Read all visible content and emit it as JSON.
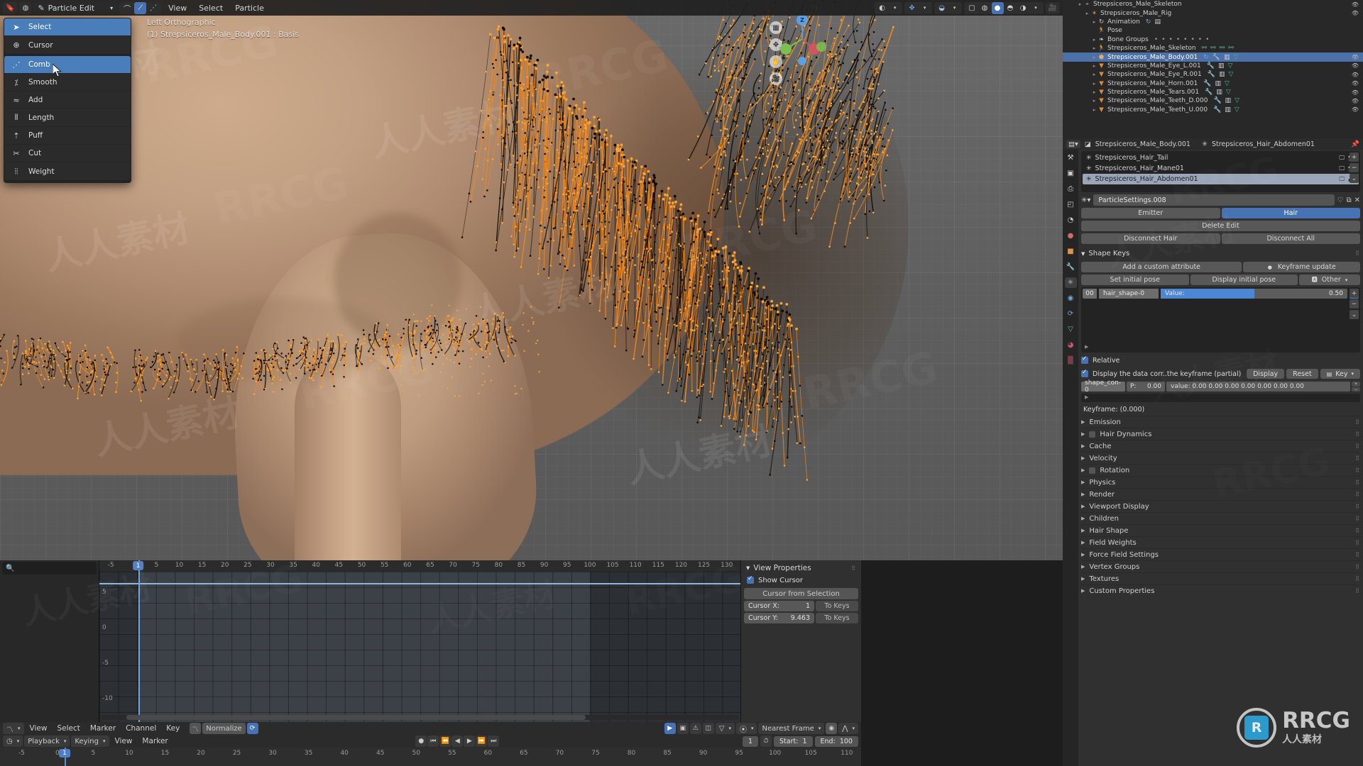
{
  "viewport": {
    "header": {
      "editor_type": "editor-type-icon",
      "mode": "Particle Edit",
      "menus": [
        "View",
        "Select",
        "Particle"
      ],
      "select_modes": [
        "path-select",
        "point-select",
        "tip-select"
      ]
    },
    "overlay_line1": "Left Orthographic",
    "overlay_line2": "(1) Strepsiceros_Male_Body.001 : Basis",
    "gizmo_axes": [
      "Z",
      "Y",
      "X"
    ]
  },
  "tool_menu": {
    "groups": [
      [
        {
          "label": "Select",
          "icon": "cursor-select-icon",
          "selected": true
        },
        {
          "label": "Cursor",
          "icon": "cursor-3d-icon",
          "selected": false
        }
      ],
      [
        {
          "label": "Comb",
          "icon": "comb-icon",
          "selected": true
        },
        {
          "label": "Smooth",
          "icon": "smooth-icon",
          "selected": false
        },
        {
          "label": "Add",
          "icon": "add-icon",
          "selected": false
        },
        {
          "label": "Length",
          "icon": "length-icon",
          "selected": false
        },
        {
          "label": "Puff",
          "icon": "puff-icon",
          "selected": false
        },
        {
          "label": "Cut",
          "icon": "cut-icon",
          "selected": false
        },
        {
          "label": "Weight",
          "icon": "weight-icon",
          "selected": false
        }
      ]
    ]
  },
  "outliner": {
    "rows": [
      {
        "label": "Strepsiceros_Male_Skeleton",
        "indent": 2,
        "icon": "armature-icon",
        "icon_color": "#d89a5a",
        "disclosure": true,
        "eye": true,
        "selected": false,
        "extra": []
      },
      {
        "label": "Strepsiceros_Male_Rig",
        "indent": 3,
        "icon": "armature-data-icon",
        "icon_color": "#e08a3c",
        "disclosure": true,
        "eye": true,
        "selected": false,
        "extra": []
      },
      {
        "label": "Animation",
        "indent": 4,
        "icon": "animation-icon",
        "icon_color": "#cfcfcf",
        "disclosure": true,
        "eye": false,
        "selected": false,
        "extra": [
          "action-icon",
          "dopesheet-icon"
        ]
      },
      {
        "label": "Pose",
        "indent": 4,
        "icon": "pose-icon",
        "icon_color": "#52b39a",
        "disclosure": false,
        "eye": false,
        "selected": false,
        "extra": []
      },
      {
        "label": "Bone Groups",
        "indent": 4,
        "icon": "bone-group-icon",
        "icon_color": "#cfcfcf",
        "disclosure": true,
        "eye": false,
        "selected": false,
        "extra": [
          "dot",
          "dot",
          "dot",
          "dot",
          "dot",
          "dot",
          "dot",
          "dot"
        ]
      },
      {
        "label": "Strepsiceros_Male_Skeleton",
        "indent": 4,
        "icon": "pose-icon",
        "icon_color": "#52b39a",
        "disclosure": true,
        "eye": false,
        "selected": false,
        "extra": [
          "bone-icon",
          "bone-icon",
          "bone-icon",
          "bone-icon"
        ]
      },
      {
        "label": "Strepsiceros_Male_Body.001",
        "indent": 4,
        "icon": "mesh-shield-icon",
        "icon_color": "#e0a96d",
        "disclosure": true,
        "eye": true,
        "selected": true,
        "extra": [
          "animation-icon",
          "modifier-icon",
          "particles-icon",
          "mesh-data-icon"
        ]
      },
      {
        "label": "Strepsiceros_Male_Eye_L.001",
        "indent": 4,
        "icon": "mesh-icon",
        "icon_color": "#e08a3c",
        "disclosure": true,
        "eye": true,
        "selected": false,
        "extra": [
          "modifier-icon",
          "particles-icon",
          "mesh-data-icon"
        ]
      },
      {
        "label": "Strepsiceros_Male_Eye_R.001",
        "indent": 4,
        "icon": "mesh-icon",
        "icon_color": "#e08a3c",
        "disclosure": true,
        "eye": true,
        "selected": false,
        "extra": [
          "modifier-icon",
          "particles-icon",
          "mesh-data-icon"
        ]
      },
      {
        "label": "Strepsiceros_Male_Horn.001",
        "indent": 4,
        "icon": "mesh-icon",
        "icon_color": "#e08a3c",
        "disclosure": true,
        "eye": true,
        "selected": false,
        "extra": [
          "modifier-icon",
          "particles-icon",
          "mesh-data-icon"
        ]
      },
      {
        "label": "Strepsiceros_Male_Tears.001",
        "indent": 4,
        "icon": "mesh-icon",
        "icon_color": "#e08a3c",
        "disclosure": true,
        "eye": true,
        "selected": false,
        "extra": [
          "modifier-icon",
          "particles-icon",
          "mesh-data-icon"
        ]
      },
      {
        "label": "Strepsiceros_Male_Teeth_D.000",
        "indent": 4,
        "icon": "mesh-icon",
        "icon_color": "#e08a3c",
        "disclosure": true,
        "eye": true,
        "selected": false,
        "extra": [
          "modifier-icon",
          "particles-icon",
          "mesh-data-icon"
        ]
      },
      {
        "label": "Strepsiceros_Male_Teeth_U.000",
        "indent": 4,
        "icon": "mesh-icon",
        "icon_color": "#e08a3c",
        "disclosure": true,
        "eye": true,
        "selected": false,
        "extra": [
          "modifier-icon",
          "particles-icon",
          "mesh-data-icon"
        ]
      }
    ]
  },
  "properties": {
    "breadcrumb": {
      "object": "Strepsiceros_Male_Body.001",
      "particle_system": "Strepsiceros_Hair_Abdomen01",
      "pin_icon": "pin-icon"
    },
    "tabs": [
      {
        "name": "tool-tab",
        "glyph": "⚒",
        "color": "#cfcfcf",
        "active": false
      },
      {
        "name": "render-tab",
        "glyph": "▣",
        "color": "#cfcfcf",
        "active": false
      },
      {
        "name": "output-tab",
        "glyph": "⎙",
        "color": "#cfcfcf",
        "active": false
      },
      {
        "name": "view-layer-tab",
        "glyph": "◰",
        "color": "#cfcfcf",
        "active": false
      },
      {
        "name": "scene-tab",
        "glyph": "◔",
        "color": "#cfcfcf",
        "active": false
      },
      {
        "name": "world-tab",
        "glyph": "●",
        "color": "#d46a6a",
        "active": false
      },
      {
        "name": "object-tab",
        "glyph": "■",
        "color": "#e0914a",
        "active": false
      },
      {
        "name": "modifier-tab",
        "glyph": "🔧",
        "color": "#6fa8dc",
        "active": false
      },
      {
        "name": "particles-tab",
        "glyph": "✳",
        "color": "#9fb4cc",
        "active": true
      },
      {
        "name": "physics-tab",
        "glyph": "◉",
        "color": "#6fa8dc",
        "active": false
      },
      {
        "name": "constraints-tab",
        "glyph": "⟳",
        "color": "#7e9fd0",
        "active": false
      },
      {
        "name": "data-tab",
        "glyph": "▽",
        "color": "#4fbf95",
        "active": false
      },
      {
        "name": "material-tab",
        "glyph": "◕",
        "color": "#c9576b",
        "active": false
      },
      {
        "name": "texture-tab",
        "glyph": "▒",
        "color": "#c9576b",
        "active": false
      }
    ],
    "particle_systems": [
      {
        "name": "Strepsiceros_Hair_Tail",
        "selected": false,
        "viewport": "monitor-icon",
        "render": "camera-icon"
      },
      {
        "name": "Strepsiceros_Hair_Mane01",
        "selected": false,
        "viewport": "monitor-icon",
        "render": "camera-icon"
      },
      {
        "name": "Strepsiceros_Hair_Abdomen01",
        "selected": true,
        "viewport": "monitor-icon",
        "render": "camera-icon"
      }
    ],
    "settings_name": "ParticleSettings.008",
    "type_toggle": {
      "options": [
        "Emitter",
        "Hair"
      ],
      "active": "Hair"
    },
    "delete_edit_label": "Delete Edit",
    "disconnect_hair_label": "Disconnect Hair",
    "disconnect_all_label": "Disconnect All",
    "shape_keys": {
      "title": "Shape Keys",
      "add_custom_attribute": "Add a custom attribute",
      "keyframe_update": "Keyframe update",
      "set_initial_pose": "Set initial pose",
      "display_initial_pose": "Display initial pose",
      "other_dropdown": "Other",
      "rows": [
        {
          "index": "00",
          "name": "hair_shape-0",
          "value_label": "Value:",
          "value": "0.50",
          "fill_pct": 50
        }
      ],
      "relative_label": "Relative",
      "relative_checked": true,
      "display_data_label": "Display the data corr..the keyframe (partial)",
      "display_data_checked": true,
      "display_btn": "Display",
      "reset_btn": "Reset",
      "key_dropdown": "Key",
      "constraint": {
        "name": "shape_con-0",
        "p_label": "P:",
        "p_value": "0.00",
        "values": "value: 0.00 0.00 0.00 0.00 0.00 0.00 0.00"
      },
      "keyframe_status": "Keyframe: (0.000)"
    },
    "sections": [
      {
        "label": "Emission",
        "has_checkbox": false
      },
      {
        "label": "Hair Dynamics",
        "has_checkbox": true
      },
      {
        "label": "Cache",
        "has_checkbox": false
      },
      {
        "label": "Velocity",
        "has_checkbox": false
      },
      {
        "label": "Rotation",
        "has_checkbox": true
      },
      {
        "label": "Physics",
        "has_checkbox": false
      },
      {
        "label": "Render",
        "has_checkbox": false
      },
      {
        "label": "Viewport Display",
        "has_checkbox": false
      },
      {
        "label": "Children",
        "has_checkbox": false
      },
      {
        "label": "Hair Shape",
        "has_checkbox": false
      },
      {
        "label": "Field Weights",
        "has_checkbox": false
      },
      {
        "label": "Force Field Settings",
        "has_checkbox": false
      },
      {
        "label": "Vertex Groups",
        "has_checkbox": false
      },
      {
        "label": "Textures",
        "has_checkbox": false
      },
      {
        "label": "Custom Properties",
        "has_checkbox": false
      }
    ]
  },
  "graph_editor": {
    "search_placeholder": "",
    "ruler_ticks": [
      -5,
      1,
      5,
      10,
      15,
      20,
      25,
      30,
      35,
      40,
      45,
      50,
      55,
      60,
      65,
      70,
      75,
      80,
      85,
      90,
      95,
      100,
      105,
      110,
      115,
      120,
      125,
      130
    ],
    "playhead_frame": 1,
    "y_labels": [
      "5",
      "0",
      "-5",
      "-10"
    ],
    "sidebar": {
      "title": "View Properties",
      "show_cursor_label": "Show Cursor",
      "show_cursor_checked": true,
      "cursor_from_selection": "Cursor from Selection",
      "cursor_x_label": "Cursor X:",
      "cursor_x_value": "1",
      "cursor_y_label": "Cursor Y:",
      "cursor_y_value": "9.463",
      "to_keys_label": "To Keys"
    },
    "header": {
      "menus": [
        "View",
        "Select",
        "Marker",
        "Channel",
        "Key"
      ],
      "normalize_label": "Normalize",
      "snap_mode": "Nearest Frame",
      "editor_icon": "graph-editor-icon"
    }
  },
  "timeline": {
    "editor_icon": "timeline-icon",
    "menus_dropdowns": [
      "Playback",
      "Keying"
    ],
    "menus": [
      "View",
      "Marker"
    ],
    "transport": [
      "jump-start-icon",
      "prev-keyframe-icon",
      "play-reverse-icon",
      "play-icon",
      "next-keyframe-icon",
      "jump-end-icon",
      "record-icon"
    ],
    "current_frame": "1",
    "start_label": "Start:",
    "start_value": "1",
    "end_label": "End:",
    "end_value": "100",
    "ruler_ticks": [
      -5,
      0,
      1,
      5,
      10,
      15,
      20,
      25,
      30,
      35,
      40,
      45,
      50,
      55,
      60,
      65,
      70,
      75,
      80,
      85,
      90,
      95,
      100,
      105,
      110
    ]
  },
  "watermark": {
    "text_latin": "RRCG",
    "text_cn": "人人素材",
    "logo_letters": "RRCG",
    "logo_sub": "人人素材"
  },
  "colors": {
    "accent_blue": "#4772b3",
    "select_blue": "#4b71a8",
    "hair_orange": "#f0881e",
    "panel_bg": "#303030",
    "outliner_bg": "#282828"
  }
}
